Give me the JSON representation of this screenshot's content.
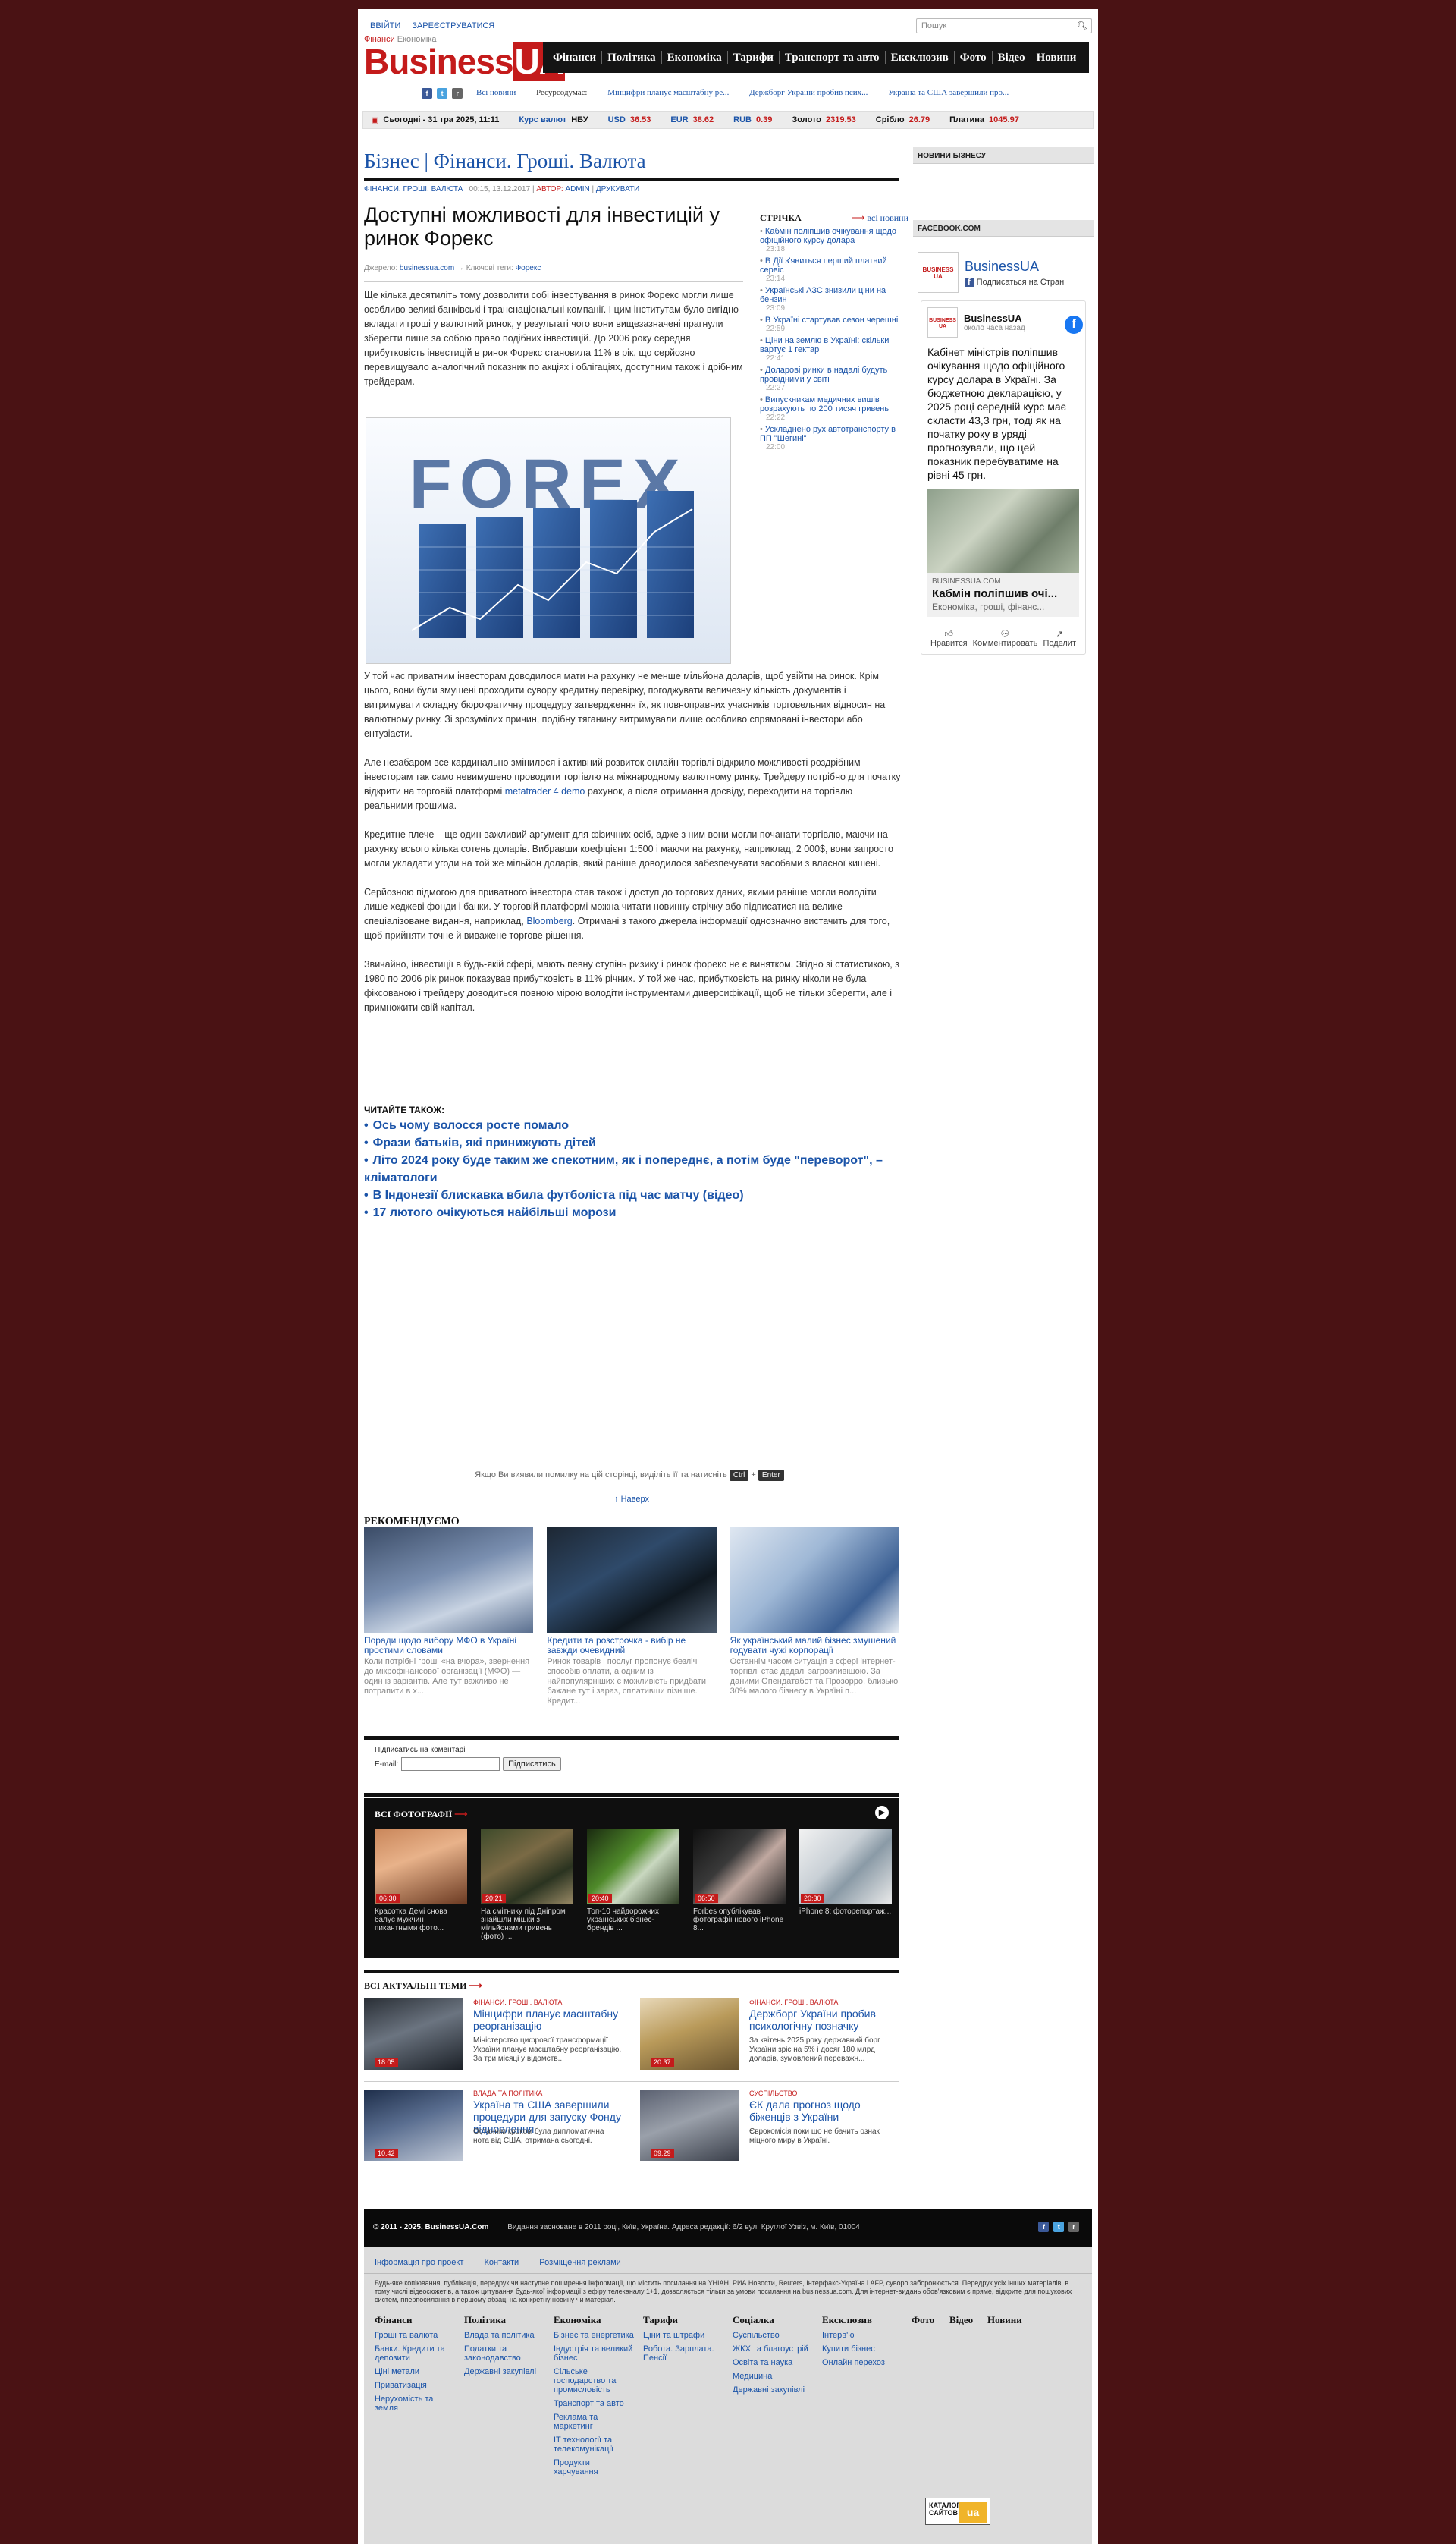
{
  "header": {
    "login": "ВВІЙТИ",
    "register": "ЗАРЕЄСТРУВАТИСЯ",
    "search_placeholder": "Пошук",
    "logo_small1": "Фінанси",
    "logo_small2": "Економіка",
    "logo_main": "Business",
    "logo_ua": "UA",
    "nav": [
      "Фінанси",
      "Політика",
      "Економіка",
      "Тарифи",
      "Транспорт та авто",
      "Ексклюзив",
      "Фото",
      "Відео",
      "Новини"
    ]
  },
  "ticker": {
    "socials_label": "Ми в соцмережах",
    "news_label": "Всі новини",
    "headlines": [
      "Ресурсодумає:",
      "Мінцифри планує масштабну ре...",
      "Держборг України пробив псих...",
      "Україна та США завершили про..."
    ]
  },
  "rates": {
    "today": "Сьогодні - 31 тра 2025, 11:11",
    "rate_label": "Курс валют",
    "nbu": "НБУ",
    "usd": "USD",
    "usd_val": "36.53",
    "eur": "EUR",
    "eur_val": "38.62",
    "rub": "RUB",
    "rub_val": "0.39",
    "gold": "Золото",
    "gold_val": "2319.53",
    "silver": "Срібло",
    "silver_val": "26.79",
    "platinum": "Платина",
    "platinum_val": "1045.97"
  },
  "section": {
    "title": "Бізнес | Фінанси. Гроші. Валюта"
  },
  "meta": {
    "category": "ФІНАНСИ. ГРОШІ. ВАЛЮТА",
    "date": "00:15, 13.12.2017",
    "author_label": "АВТОР:",
    "author": "ADMIN",
    "print": "ДРУКУВАТИ"
  },
  "article": {
    "title": "Доступні можливості для інвестицій у ринок Форекс",
    "source_label": "Джерело:",
    "source": "businessua.com",
    "tags_label": "→ Ключові теги:",
    "tag": "Форекс",
    "intro": "Ще кілька десятиліть тому дозволити собі інвестування в ринок Форекс могли лише особливо великі банківські і транснаціональні компанії. І цим інститутам було вигідно вкладати гроші у валютний ринок, у результаті чого вони вищезазначені прагнули зберегти лише за собою право подібних інвестицій. До 2006 року середня прибутковість інвестицій в ринок Форекс становила 11% в рік, що серйозно перевищувало аналогічний показник по акціях і облігаціях, доступним також і дрібним трейдерам.",
    "image_text": "FOREX",
    "p2": "У той час приватним інвесторам доводилося мати на рахунку не менше мільйона доларів, щоб увійти на ринок. Крім цього, вони були змушені проходити сувору кредитну перевірку, погоджувати величезну кількість документів і витримувати складну бюрократичну процедуру затвердження їх, як повноправних учасників торговельних відносин на валютному ринку. Зі зрозумілих причин, подібну тяганину витримували лише особливо спрямовані інвестори або ентузіасти.",
    "p3a": "Але незабаром все кардинально змінилося і активний розвиток онлайн торгівлі відкрило можливості роздрібним інвесторам так само невимушено проводити торгівлю на міжнародному валютному ринку. Трейдеру потрібно для початку відкрити на торговій платформі",
    "p3link": "metatrader 4 demo",
    "p3b": "рахунок, а після отримання досвіду, переходити на торгівлю реальними грошима.",
    "p4": "Кредитне плече – ще один важливий аргумент для фізичних осіб, адже з ним вони могли почанати торгівлю, маючи на рахунку всього кілька сотень доларів. Вибравши коефіцієнт 1:500 і маючи на рахунку, наприклад, 2 000$, вони запросто могли укладати угоди на той же мільйон доларів, який раніше доводилося забезпечувати засобами з власної кишені.",
    "p5a": "Серйозною підмогою для приватного інвестора став також і доступ до торгових даних, якими раніше могли володіти лише хеджеві фонди і банки. У торговій платформі можна читати новинну стрічку або підписатися на велике спеціалізоване видання, наприклад,",
    "p5link": "Bloomberg",
    "p5b": ". Отримані з такого джерела інформації однозначно вистачить для того, щоб прийняти точне й виважене торгове рішення.",
    "p6": "Звичайно, інвестиції в будь-якій сфері, мають певну ступінь ризику і ринок форекс не є винятком. Згідно зі статистикою, з 1980 по 2006 рік ринок показував прибутковість в 11% річних. У той же час, прибутковість на ринку ніколи не була фіксованою і трейдеру доводиться повною мірою володіти інструментами диверсифікації, щоб не тільки зберегти, але і примножити свій капітал."
  },
  "read_also": {
    "heading": "ЧИТАЙТЕ ТАКОЖ:",
    "items": [
      "Ось чому волосся росте помало",
      "Фрази батьків, які принижують дітей",
      "Літо 2024 року буде таким же спекотним, як і попереднє, а потім буде \"переворот\", – кліматологи",
      "В Індонезії блискавка вбила футболіста під час матчу (відео)",
      "17 лютого очікуються найбільші морози"
    ]
  },
  "stream": {
    "heading": "СТРІЧКА",
    "all": "всі новини",
    "items": [
      {
        "title": "Кабмін поліпшив очікування щодо офіційного курсу долара",
        "time": "23:18"
      },
      {
        "title": "В Дії з'явиться перший платний сервіс",
        "time": "23:14"
      },
      {
        "title": "Українські АЗС знизили ціни на бензин",
        "time": "23:09"
      },
      {
        "title": "В Україні стартував сезон черешні",
        "time": "22:59"
      },
      {
        "title": "Ціни на землю в Україні: скільки вартує 1 гектар",
        "time": "22:41"
      },
      {
        "title": "Доларові ринки в надалі будуть провідними у світі",
        "time": "22:27"
      },
      {
        "title": "Випускникам медичних вишів розрахують по 200 тисяч гривень",
        "time": "22:22"
      },
      {
        "title": "Ускладнено рух автотранспорту в ПП \"Шегині\"",
        "time": "22:00"
      }
    ]
  },
  "sidebar": {
    "news_head": "НОВИНИ БІЗНЕСУ",
    "fb_head": "FACEBOOK.COM",
    "fb_page_name": "BusinessUA",
    "fb_subscribe": "Подписаться на Стран",
    "fb_logo": "BUSINESS UA",
    "post_name": "BusinessUA",
    "post_time": "около часа назад",
    "post_text": "Кабінет міністрів поліпшив очікування щодо офіційного курсу долара в Україні. За бюджетною декларацією, у 2025 році середній курс має скласти 43,3 грн, тоді як на початку року в уряді прогнозували, що цей показник перебуватиме на рівні 45 грн.",
    "post_domain": "BUSINESSUA.COM",
    "post_cap_title": "Кабмін поліпшив очі...",
    "post_cap_desc": "Економіка, гроші, фінанс...",
    "action_like": "Нравится",
    "action_comment": "Комментировать",
    "action_share": "Поделит"
  },
  "bottom": {
    "error_text": "Якщо Ви виявили помилку на цій сторінці, виділіть її та натисніть",
    "ctrl": "Ctrl",
    "enter": "Enter",
    "to_top": "↑ Наверх",
    "rec_head": "РЕКОМЕНДУЄМО",
    "recs": [
      {
        "title": "Поради щодо вибору МФО в Україні простими словами",
        "desc": "Коли потрібні гроші «на вчора», звернення до мікрофінансової організації (МФО) — один із варіантів. Але тут важливо не потрапити в х..."
      },
      {
        "title": "Кредити та розстрочка - вибір не завжди очевидний",
        "desc": "Ринок товарів і послуг пропонує безліч способів оплати, а одним із найпопулярніших є можливість придбати бажане тут і зараз, сплативши пізніше. Кредит..."
      },
      {
        "title": "Як український малий бізнес змушений годувати чужі корпорації",
        "desc": "Останнім часом ситуація в сфері інтернет-торгівлі стає дедалі загрозливішою. За даними Опендатабот та Прозорро, близько 30% малого бізнесу в Україні п..."
      }
    ],
    "sub_label": "Підписатись на коментарі",
    "sub_email": "E-mail:",
    "sub_button": "Підписатись",
    "photos_head": "ВСІ ФОТОГРАФІЇ",
    "photos": [
      {
        "time": "06:30",
        "title": "Красотка Демі снова балує мужчин пикантными фото..."
      },
      {
        "time": "20:21",
        "title": "На смітнику під Дніпром знайшли мішки з мільйонами гривень (фото) ..."
      },
      {
        "time": "20:40",
        "title": "Топ-10 найдорожчих українських бізнес-брендів ..."
      },
      {
        "time": "06:50",
        "title": "Forbes опублікував фотографії нового iPhone 8..."
      },
      {
        "time": "20:30",
        "title": "iPhone 8: фоторепортаж..."
      }
    ],
    "topics_head": "ВСІ АКТУАЛЬНІ ТЕМИ",
    "topics": [
      {
        "time": "18:05",
        "cat": "ФІНАНСИ. ГРОШІ. ВАЛЮТА",
        "title": "Мінцифри планує масштабну реорганізацію",
        "desc": "Міністерство цифрової трансформації України планує масштабну реорганізацію. За три місяці у відомств..."
      },
      {
        "time": "20:37",
        "cat": "ФІНАНСИ. ГРОШІ. ВАЛЮТА",
        "title": "Держборг України пробив психологічну позначку",
        "desc": "За квітень 2025 року державний борг України зріс на 5% і досяг 180 млрд доларів, зумовлений переважн..."
      },
      {
        "time": "10:42",
        "cat": "ВЛАДА ТА ПОЛІТИКА",
        "title": "Україна та США завершили процедури для запуску Фонду відновлення",
        "desc": "Останнім кроком була дипломатична нота від США, отримана сьогодні."
      },
      {
        "time": "09:29",
        "cat": "СУСПІЛЬСТВО",
        "title": "ЄК дала прогноз щодо біженців з України",
        "desc": "Єврокомісія поки що не бачить ознак міцного миру в Україні."
      }
    ]
  },
  "footer": {
    "copyright": "© 2011 - 2025. BusinessUA.Com",
    "info": "Видання засноване в 2011 році, Київ, Україна. Адреса редакції: 6/2 вул. Круглої Узвіз, м. Київ, 01004",
    "links": [
      "Інформація про проект",
      "Контакти",
      "Розміщення реклами"
    ],
    "note": "Будь-яке копіювання, публікація, передрук чи наступне поширення інформації, що містить посилання на УНІАН, РИА Новости, Reuters, Інтерфакс-Україна і АFP, суворо заборонюється. Передрук усіх інших матеріалів, в тому числі відеосюжетів, а також цитування будь-якої інформації з ефіру телеканалу 1+1, дозволяється тільки за умови посилання на businessua.com. Для інтернет-видань обов'язковим є пряме, відкрите для пошукових систем, гіперпосилання в першому абзаці на конкретну новину чи матеріал.",
    "columns": [
      {
        "head": "Фінанси",
        "items": [
          "Гроші та валюта",
          "Банки. Кредити та депозити",
          "Ціні метали",
          "Приватизація",
          "Нерухомість та земля"
        ]
      },
      {
        "head": "Політика",
        "items": [
          "Влада та політика",
          "Податки та законодавство",
          "Державні закупівлі"
        ]
      },
      {
        "head": "Економіка",
        "items": [
          "Бізнес та енергетика",
          "Індустрія та великий бізнес",
          "Сільське господарство та промисловість",
          "Транспорт та авто",
          "Реклама та маркетинг",
          "IT технології та телекомунікації",
          "Продукти харчування"
        ]
      },
      {
        "head": "Тарифи",
        "items": [
          "Ціни та штрафи",
          "Робота. Зарплата. Пенсії"
        ]
      },
      {
        "head": "Соціалка",
        "items": [
          "Суспільство",
          "ЖКХ та благоустрій",
          "Освіта та наука",
          "Медицина",
          "Державні закупівлі"
        ]
      },
      {
        "head": "Ексклюзив",
        "items": [
          "Інтерв'ю",
          "Купити бізнес",
          "Онлайн перехоз"
        ]
      },
      {
        "head": "Фото",
        "items": []
      },
      {
        "head": "Відео",
        "items": []
      },
      {
        "head": "Новини",
        "items": []
      }
    ],
    "badge": "КАТАЛОГ САЙТОВ",
    "badge_ua": "ua"
  },
  "colors": {
    "brand_red": "#c41b1b",
    "link_blue": "#1a53a8",
    "background": "#4a1214"
  }
}
